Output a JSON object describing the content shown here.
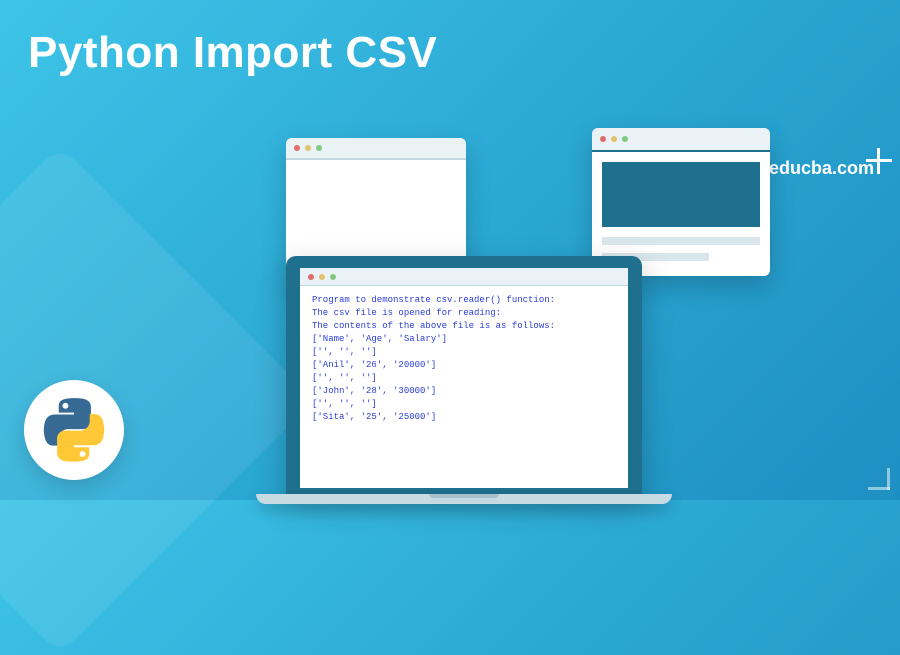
{
  "title": "Python Import CSV",
  "website": "www.educba.com",
  "logo_name": "python-logo",
  "terminal": {
    "lines": [
      "Program to demonstrate csv.reader() function:",
      "",
      "",
      "The csv file is opened for reading:",
      "",
      "",
      "The contents of the above file is as follows:",
      "['Name', 'Age', 'Salary']",
      "['', '', '']",
      "['Anil', '26', '20000']",
      "['', '', '']",
      "['John', '28', '30000']",
      "['', '', '']",
      "['Sita', '25', '25000']"
    ]
  }
}
